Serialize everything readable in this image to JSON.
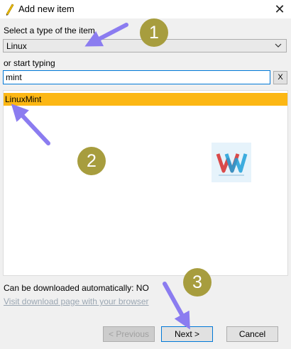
{
  "window": {
    "title": "Add new item",
    "close_glyph": "✕"
  },
  "type_select": {
    "label": "Select a type of the item",
    "value": "Linux"
  },
  "search": {
    "label": "or start typing",
    "value": "mint",
    "clear_label": "X"
  },
  "results": [
    {
      "label": "LinuxMint",
      "selected": true
    }
  ],
  "status": {
    "download_text": "Can be downloaded automatically: NO",
    "link_text": "Visit download page with your browser"
  },
  "buttons": {
    "previous": "< Previous",
    "next": "Next >",
    "cancel": "Cancel"
  },
  "annotations": {
    "badges": [
      "1",
      "2",
      "3"
    ],
    "badge_color": "#a79d3e",
    "arrow_color": "#8b7cf0"
  },
  "colors": {
    "selection": "#fcb714",
    "focus_border": "#0078d7"
  },
  "icons": {
    "title": "pencil-icon",
    "select_chevron": "chevron-down-icon"
  }
}
